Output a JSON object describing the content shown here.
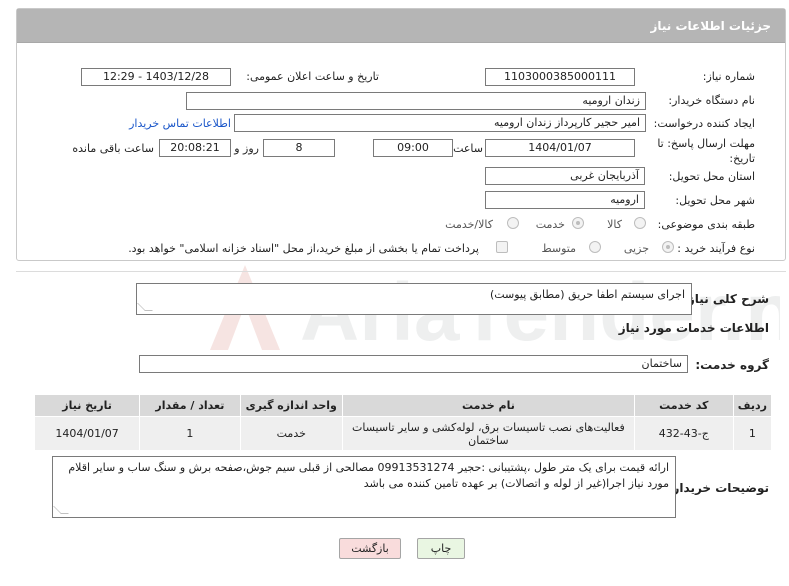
{
  "header": {
    "title": "جزئیات اطلاعات نیاز"
  },
  "form": {
    "need_number_label": "شماره نیاز:",
    "need_number": "1103000385000111",
    "announce_label": "تاریخ و ساعت اعلان عمومی:",
    "announce_value": "1403/12/28 - 12:29",
    "buyer_org_label": "نام دستگاه خریدار:",
    "buyer_org": "زندان ارومیه",
    "creator_label": "ایجاد کننده درخواست:",
    "creator": "امیر حجیر کارپرداز زندان ارومیه",
    "contact_link": "اطلاعات تماس خریدار",
    "deadline_label": "مهلت ارسال پاسخ: تا تاریخ:",
    "deadline_date": "1404/01/07",
    "time_label": "ساعت",
    "deadline_time": "09:00",
    "days_value": "8",
    "days_label": "روز و",
    "remaining_time": "20:08:21",
    "remaining_label": "ساعت باقی مانده",
    "province_label": "استان محل تحویل:",
    "province": "آذربایجان غربی",
    "city_label": "شهر محل تحویل:",
    "city": "ارومیه",
    "category_label": "طبقه بندی موضوعی:",
    "category_options": [
      "کالا",
      "خدمت",
      "کالا/خدمت"
    ],
    "category_selected": "خدمت",
    "process_label": "نوع فرآیند خرید :",
    "process_options": [
      "جزیی",
      "متوسط"
    ],
    "process_selected": "جزیی",
    "payment_note": "پرداخت تمام یا بخشی از مبلغ خرید،از محل \"اسناد خزانه اسلامی\" خواهد بود."
  },
  "summary": {
    "label": "شرح کلی نیاز:",
    "value": "اجرای سیستم اطفا حریق (مطابق پیوست)"
  },
  "services": {
    "section_title": "اطلاعات خدمات مورد نیاز",
    "group_label": "گروه خدمت:",
    "group_value": "ساختمان",
    "columns": [
      "ردیف",
      "کد خدمت",
      "نام خدمت",
      "واحد اندازه گیری",
      "تعداد / مقدار",
      "تاریخ نیاز"
    ],
    "rows": [
      {
        "index": "1",
        "code": "ج-43-432",
        "name": "فعالیت‌های نصب تاسیسات برق، لوله‌کشی و سایر تاسیسات ساختمان",
        "unit": "خدمت",
        "qty": "1",
        "date": "1404/01/07"
      }
    ]
  },
  "buyer_notes": {
    "label": "توضیحات خریدار:",
    "text": "ارائه قیمت برای یک متر طول ،پشتیبانی :حجیر 09913531274 مصالحی از قبلی سیم جوش،صفحه برش و سنگ ساب و سایر اقلام مورد نیاز اجرا(غیر از لوله و اتصالات) بر عهده تامین کننده می باشد"
  },
  "buttons": {
    "print": "چاپ",
    "back": "بازگشت"
  },
  "watermark": {
    "text": "AriaTender.neT"
  },
  "colors": {
    "header_bg": "#b5b5b5",
    "link": "#1a56c9",
    "back_btn_bg": "#f9dcdc",
    "print_btn_bg": "#e9f6e2"
  }
}
